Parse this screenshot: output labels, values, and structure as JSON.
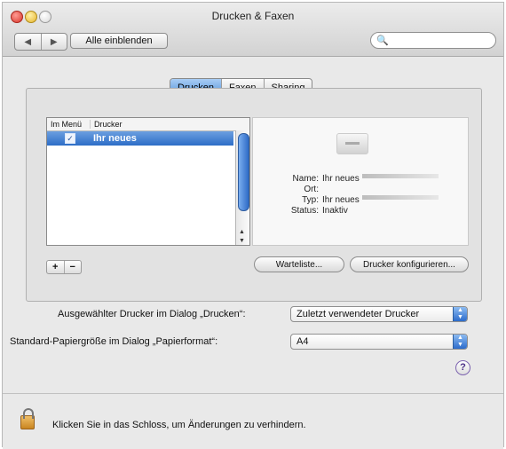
{
  "window": {
    "title": "Drucken & Faxen"
  },
  "toolbar": {
    "back": "◀",
    "forward": "▶",
    "show_all": "Alle einblenden",
    "search_placeholder": ""
  },
  "tabs": [
    {
      "label": "Drucken",
      "active": true
    },
    {
      "label": "Faxen",
      "active": false
    },
    {
      "label": "Sharing",
      "active": false
    }
  ],
  "printer_list": {
    "headers": [
      "Im Menü",
      "Drucker"
    ],
    "rows": [
      {
        "checked": true,
        "name": "Ihr neues"
      }
    ]
  },
  "details": {
    "name_label": "Name:",
    "name_value": "Ihr neues",
    "location_label": "Ort:",
    "location_value": "",
    "type_label": "Typ:",
    "type_value": "Ihr neues",
    "status_label": "Status:",
    "status_value": "Inaktiv"
  },
  "buttons": {
    "add": "+",
    "remove": "−",
    "queue": "Warteliste...",
    "configure": "Drucker konfigurieren..."
  },
  "settings": {
    "dialog_printer_label": "Ausgewählter Drucker im Dialog „Drucken“:",
    "dialog_printer_value": "Zuletzt verwendeter Drucker",
    "paper_size_label": "Standard-Papiergröße im Dialog „Papierformat“:",
    "paper_size_value": "A4"
  },
  "help": "?",
  "footer": {
    "lock_text": "Klicken Sie in das Schloss, um Änderungen zu verhindern."
  }
}
